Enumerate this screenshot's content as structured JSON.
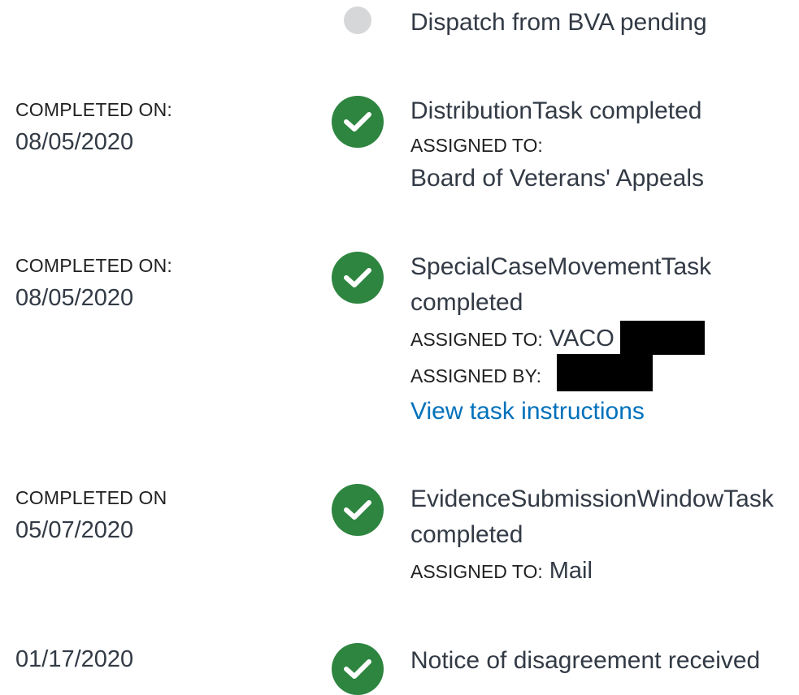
{
  "timeline": {
    "pending": {
      "title": "Dispatch from BVA pending"
    },
    "items": [
      {
        "date_label": "COMPLETED ON:",
        "date": "08/05/2020",
        "title": "DistributionTask completed",
        "assigned_to_label": "ASSIGNED TO:",
        "assigned_to": "Board of Veterans' Appeals",
        "icon": "check-circle-icon",
        "status_color": "#2e8540"
      },
      {
        "date_label": "COMPLETED ON:",
        "date": "08/05/2020",
        "title_line1": "SpecialCaseMovementTask",
        "title_line2": "completed",
        "assigned_to_label": "ASSIGNED TO:",
        "assigned_to": "VACO",
        "assigned_by_label": "ASSIGNED BY:",
        "link": "View task instructions",
        "icon": "check-circle-icon",
        "status_color": "#2e8540"
      },
      {
        "date_label": "COMPLETED ON",
        "date": "05/07/2020",
        "title_line1": "EvidenceSubmissionWindowTask",
        "title_line2": "completed",
        "assigned_to_label": "ASSIGNED TO:",
        "assigned_to": "Mail",
        "icon": "check-circle-icon",
        "status_color": "#2e8540"
      },
      {
        "date": "01/17/2020",
        "title": "Notice of disagreement received",
        "icon": "check-circle-icon",
        "status_color": "#2e8540"
      }
    ]
  },
  "colors": {
    "link": "#0071bb",
    "pending_dot": "#d6d7d9",
    "text": "#323a45"
  }
}
